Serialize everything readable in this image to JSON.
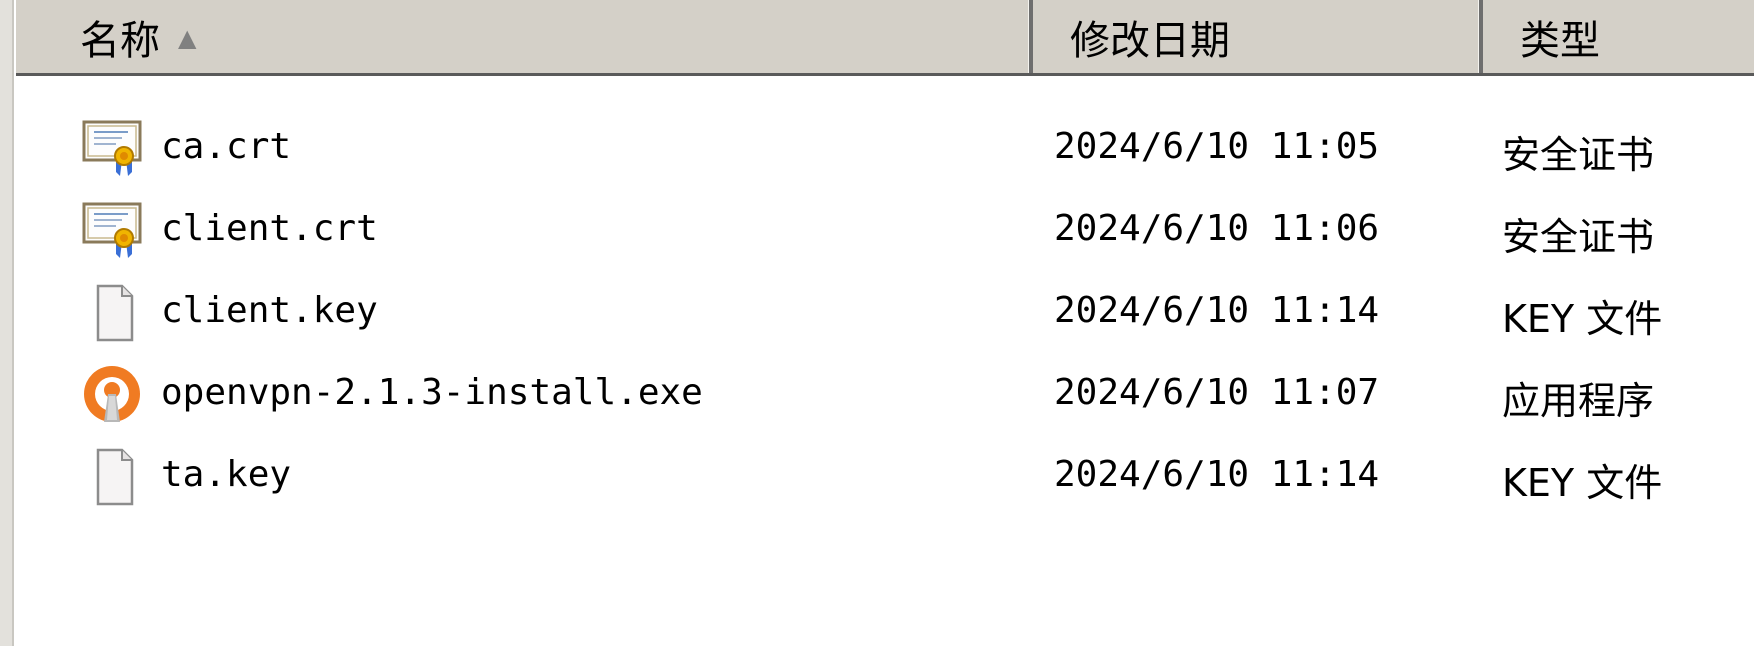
{
  "header": {
    "name_label": "名称",
    "date_label": "修改日期",
    "type_label": "类型",
    "sort_indicator": "▲"
  },
  "files": [
    {
      "name": "ca.crt",
      "date": "2024/6/10 11:05",
      "type": "安全证书",
      "icon": "certificate-icon"
    },
    {
      "name": "client.crt",
      "date": "2024/6/10 11:06",
      "type": "安全证书",
      "icon": "certificate-icon"
    },
    {
      "name": "client.key",
      "date": "2024/6/10 11:14",
      "type": "KEY 文件",
      "icon": "blank-file-icon"
    },
    {
      "name": "openvpn-2.1.3-install.exe",
      "date": "2024/6/10 11:07",
      "type": "应用程序",
      "icon": "openvpn-icon"
    },
    {
      "name": "ta.key",
      "date": "2024/6/10 11:14",
      "type": "KEY 文件",
      "icon": "blank-file-icon"
    }
  ],
  "colors": {
    "header_bg": "#d4d0c8",
    "openvpn_orange": "#f07b22"
  }
}
